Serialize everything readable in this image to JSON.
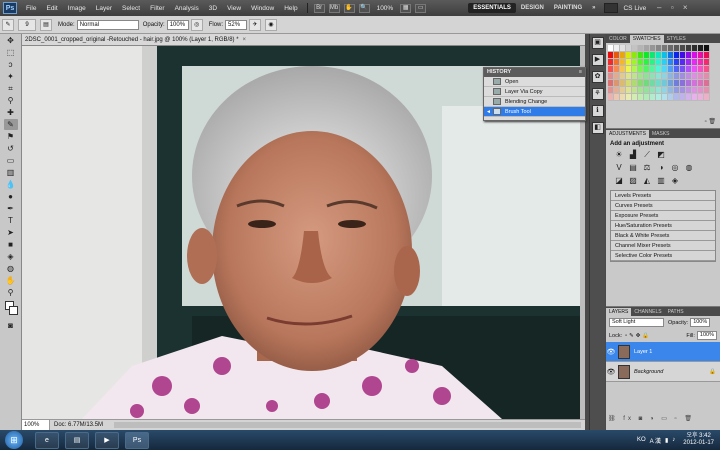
{
  "menubar": {
    "logo": "Ps",
    "items": [
      "File",
      "Edit",
      "Image",
      "Layer",
      "Select",
      "Filter",
      "Analysis",
      "3D",
      "View",
      "Window",
      "Help"
    ],
    "zoom": "100%",
    "workspaces": [
      "ESSENTIALS",
      "DESIGN",
      "PAINTING",
      "»"
    ],
    "cslive": "CS Live"
  },
  "options": {
    "brush_size": "9",
    "mode_label": "Mode:",
    "mode_value": "Normal",
    "opacity_label": "Opacity:",
    "opacity_value": "100%",
    "flow_label": "Flow:",
    "flow_value": "52%"
  },
  "document": {
    "tab_title": "2DSC_0001_cropped_original -Retouched - hair.jpg @ 100% (Layer 1, RGB/8) *",
    "status_zoom": "100%",
    "status_doc": "Doc: 6.77M/13.5M"
  },
  "history": {
    "title": "HISTORY",
    "items": [
      "Open",
      "Layer Via Copy",
      "Blending Change",
      "Brush Tool"
    ],
    "selected": 3
  },
  "dock": {
    "swatch_tabs": [
      "COLOR",
      "SWATCHES",
      "STYLES"
    ],
    "adjust_tabs": [
      "ADJUSTMENTS",
      "MASKS"
    ],
    "adjust_title": "Add an adjustment",
    "presets": [
      "Levels Presets",
      "Curves Presets",
      "Exposure Presets",
      "Hue/Saturation Presets",
      "Black & White Presets",
      "Channel Mixer Presets",
      "Selective Color Presets"
    ],
    "layer_tabs": [
      "LAYERS",
      "CHANNELS",
      "PATHS"
    ],
    "blend_mode": "Soft Light",
    "opacity_label": "Opacity:",
    "opacity_value": "100%",
    "lock_label": "Lock:",
    "fill_label": "Fill:",
    "fill_value": "100%",
    "layers": [
      "Layer 1",
      "Background"
    ]
  },
  "taskbar": {
    "time": "오후 3:42",
    "date": "2012-01-17",
    "lang": "KO",
    "ime": "A 漢"
  }
}
